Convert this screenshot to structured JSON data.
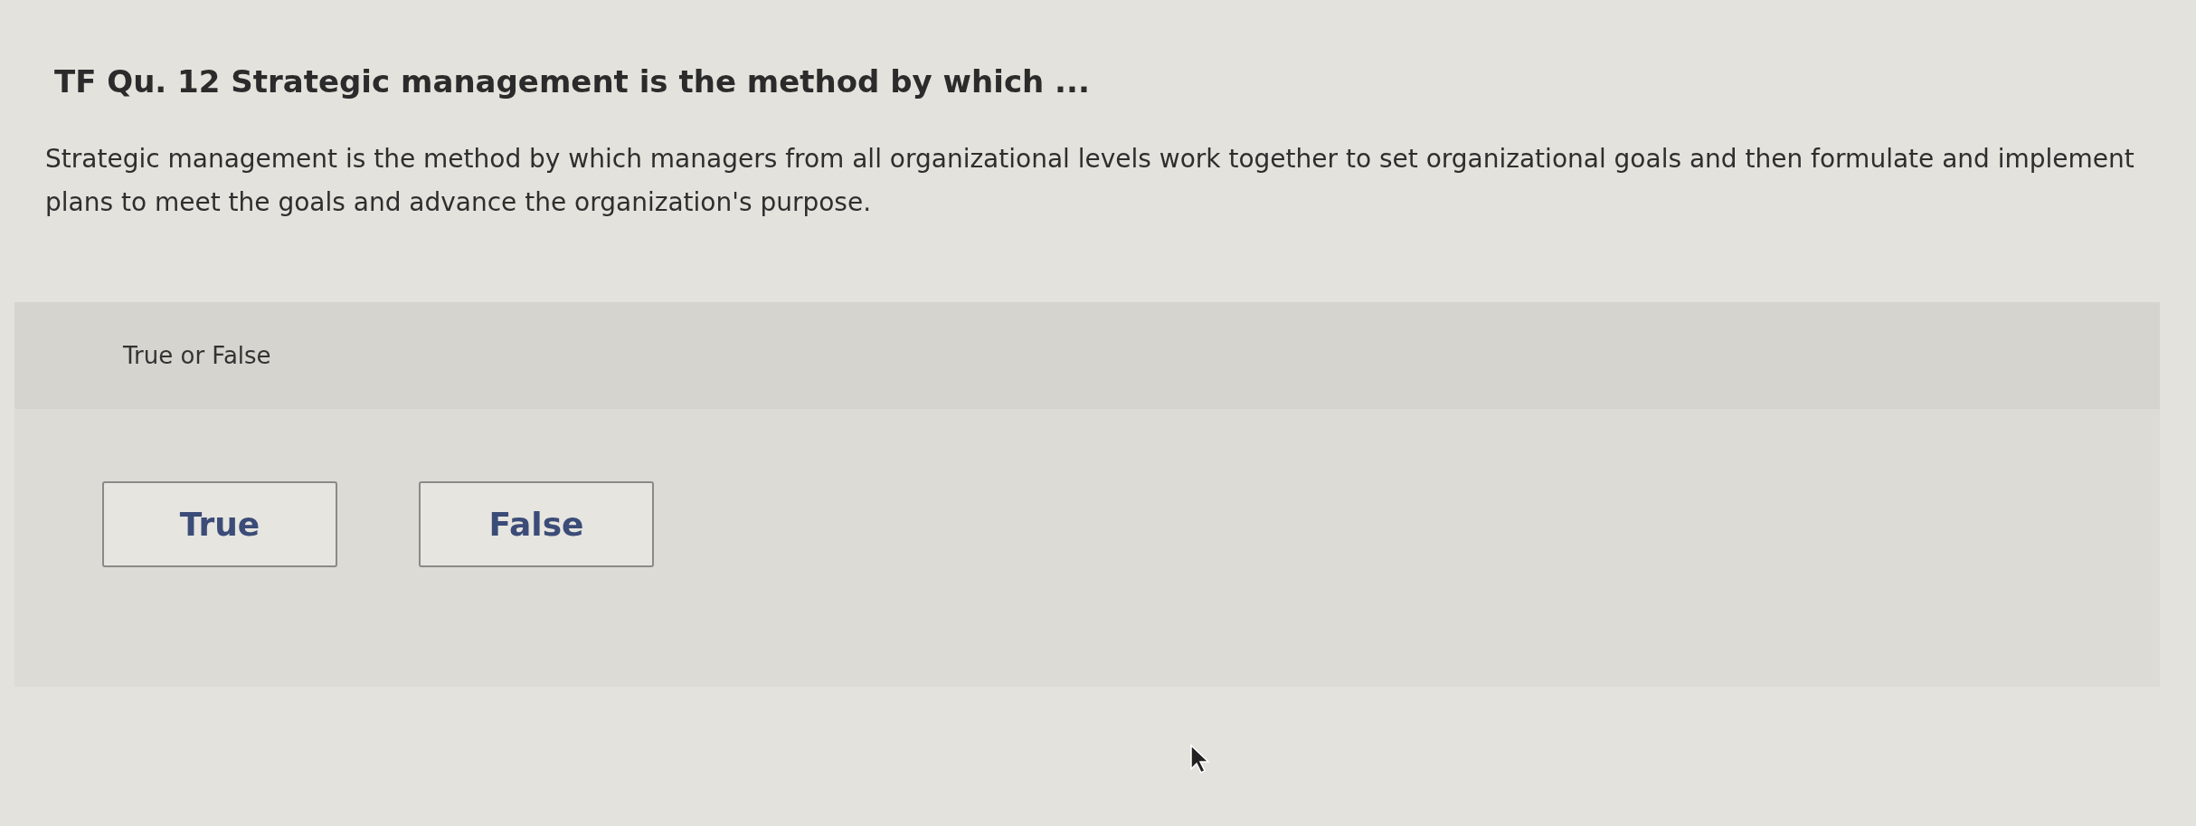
{
  "question": {
    "title": "TF Qu. 12 Strategic management is the method by which ...",
    "text": "Strategic management is the method by which managers from all organizational levels work together to set organizational goals and then formulate and implement plans to meet the goals and advance the organization's purpose."
  },
  "answer_panel": {
    "prompt": "True or False",
    "options": [
      {
        "label": "True",
        "selected": false
      },
      {
        "label": "False",
        "selected": false
      }
    ]
  }
}
